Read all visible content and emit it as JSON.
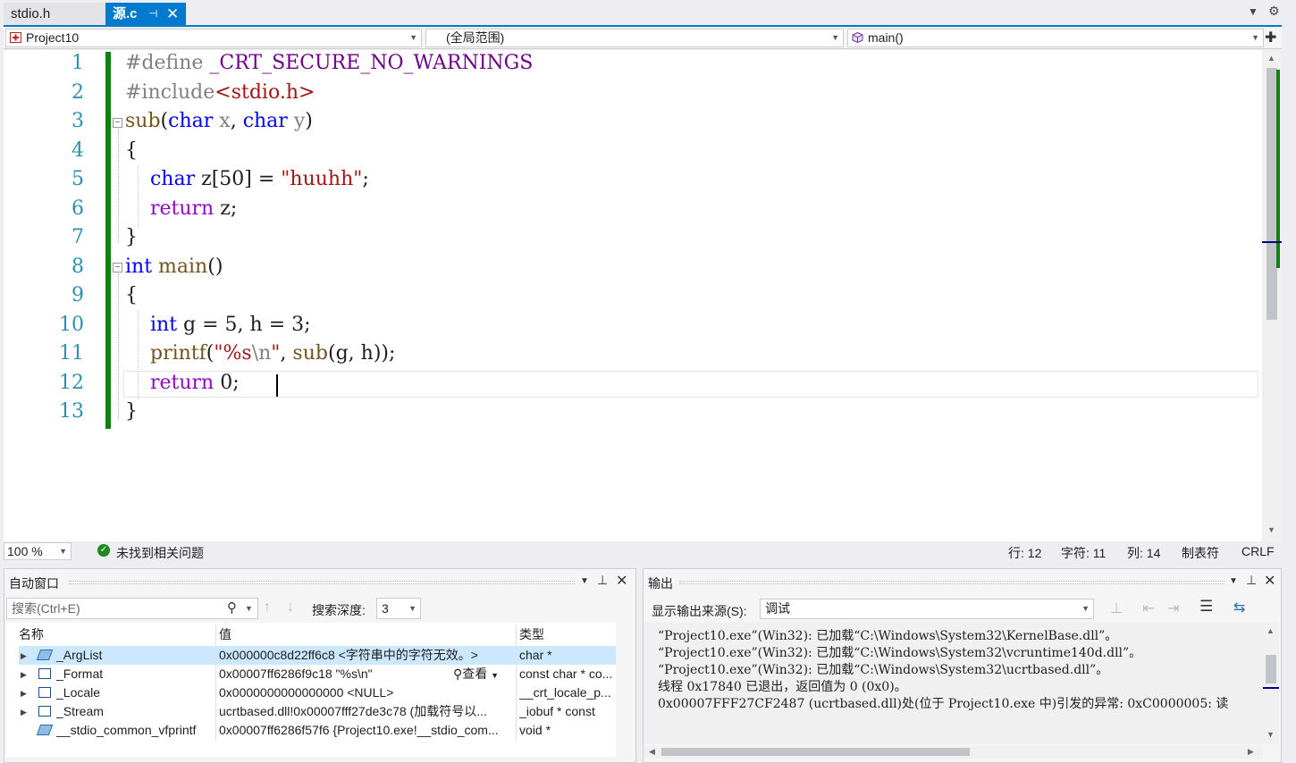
{
  "tabs": [
    {
      "label": "stdio.h",
      "active": false
    },
    {
      "label": "源.c",
      "active": true
    }
  ],
  "nav": {
    "project": "Project10",
    "scope": "(全局范围)",
    "function": "main()"
  },
  "code": {
    "line_numbers": [
      "1",
      "2",
      "3",
      "4",
      "5",
      "6",
      "7",
      "8",
      "9",
      "10",
      "11",
      "12",
      "13"
    ],
    "lines": [
      "#define _CRT_SECURE_NO_WARNINGS",
      "#include<stdio.h>",
      "sub(char x, char y)",
      "{",
      "    char z[50] = \"huuhh\";",
      "    return z;",
      "}",
      "int main()",
      "{",
      "    int g = 5, h = 3;",
      "    printf(\"%s\\n\", sub(g, h));",
      "    return 0;",
      "}"
    ],
    "current_line": 12
  },
  "status": {
    "zoom": "100 %",
    "issues": "未找到相关问题",
    "line": "行: 12",
    "char": "字符: 11",
    "col": "列: 14",
    "tabs": "制表符",
    "eol": "CRLF"
  },
  "autos": {
    "title": "自动窗口",
    "search_placeholder": "搜索(Ctrl+E)",
    "depth_label": "搜索深度:",
    "depth_value": "3",
    "columns": [
      "名称",
      "值",
      "类型"
    ],
    "rows": [
      {
        "name": "_ArgList",
        "value": "0x000000c8d22ff6c8 <字符串中的字符无效。>",
        "type": "char *",
        "expandable": true,
        "selected": true
      },
      {
        "name": "_Format",
        "value": "0x00007ff6286f9c18 \"%s\\n\"",
        "view": "查看",
        "type": "const char * co...",
        "expandable": true
      },
      {
        "name": "_Locale",
        "value": "0x0000000000000000 <NULL>",
        "type": "__crt_locale_p...",
        "expandable": true
      },
      {
        "name": "_Stream",
        "value": "ucrtbased.dll!0x00007fff27de3c78 (加载符号以...",
        "type": "_iobuf * const",
        "expandable": true
      },
      {
        "name": "__stdio_common_vfprintf",
        "value": "0x00007ff6286f57f6 {Project10.exe!__stdio_com...",
        "type": "void *",
        "expandable": false
      }
    ]
  },
  "output": {
    "title": "输出",
    "source_label": "显示输出来源(S):",
    "source_value": "调试",
    "lines": [
      "“Project10.exe”(Win32): 已加载“C:\\Windows\\System32\\KernelBase.dll”。",
      "“Project10.exe”(Win32): 已加载“C:\\Windows\\System32\\vcruntime140d.dll”。",
      "“Project10.exe”(Win32): 已加载“C:\\Windows\\System32\\ucrtbased.dll”。",
      "线程 0x17840 已退出，返回值为 0 (0x0)。",
      "0x00007FFF27CF2487 (ucrtbased.dll)处(位于 Project10.exe 中)引发的异常: 0xC0000005: 读"
    ]
  },
  "colors": {
    "accent": "#007acc",
    "keyword": "#0000ff",
    "string": "#a31515",
    "line_number": "#2b91af",
    "change_bar": "#108010"
  }
}
